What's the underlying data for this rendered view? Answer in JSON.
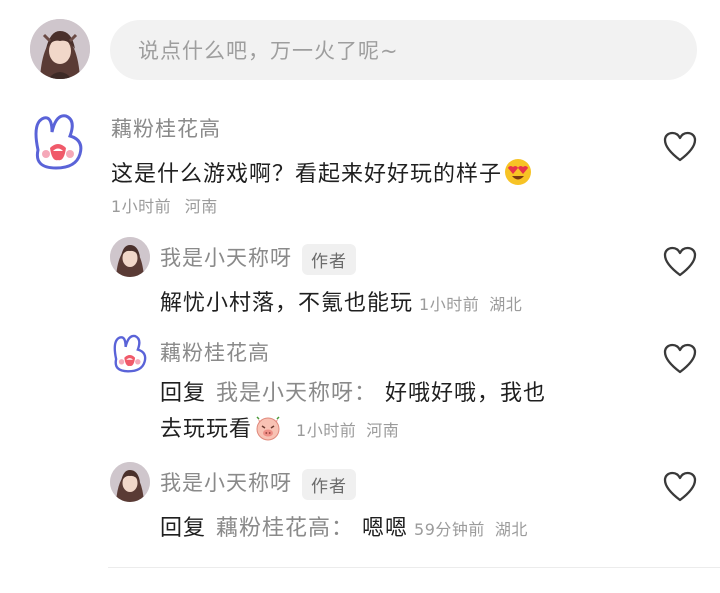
{
  "composer": {
    "placeholder": "说点什么吧，万一火了呢~"
  },
  "comments": [
    {
      "user": "藕粉桂花高",
      "text": "这是什么游戏啊？看起来好好玩的样子",
      "emoji": "heart-eyes-emoji",
      "time": "1小时前",
      "location": "河南"
    },
    {
      "user": "我是小天称呀",
      "badge": "作者",
      "text": "解忧小村落，不氪也能玩",
      "time": "1小时前",
      "location": "湖北"
    },
    {
      "user": "藕粉桂花高",
      "reply_prefix": "回复",
      "reply_to": "我是小天称呀：",
      "text_line1": "好哦好哦，我也",
      "text_line2": "去玩玩看",
      "emoji": "pig-face-emoji",
      "time": "1小时前",
      "location": "河南"
    },
    {
      "user": "我是小天称呀",
      "badge": "作者",
      "reply_prefix": "回复",
      "reply_to": "藕粉桂花高：",
      "text": "嗯嗯",
      "time": "59分钟前",
      "location": "湖北"
    }
  ],
  "colors": {
    "name": "#8a8a8a",
    "meta": "#9b9b9b",
    "input_bg": "#f2f2f2"
  },
  "icons": {
    "like": "heart-outline-icon"
  }
}
